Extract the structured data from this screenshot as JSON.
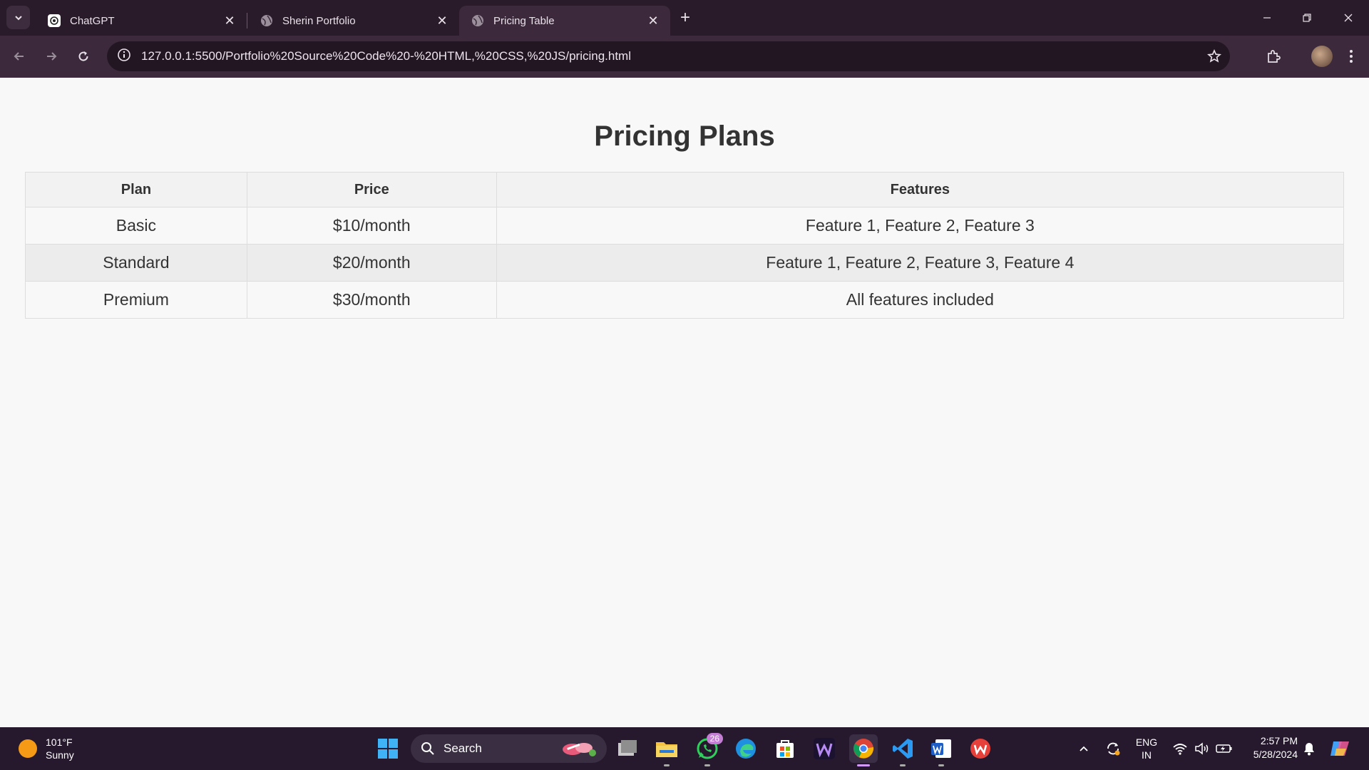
{
  "browser": {
    "tabs": [
      {
        "title": "ChatGPT",
        "favicon": "chatgpt-icon"
      },
      {
        "title": "Sherin Portfolio",
        "favicon": "globe-icon"
      },
      {
        "title": "Pricing Table",
        "favicon": "globe-icon",
        "active": true
      }
    ],
    "url": "127.0.0.1:5500/Portfolio%20Source%20Code%20-%20HTML,%20CSS,%20JS/pricing.html"
  },
  "page": {
    "title": "Pricing Plans",
    "table": {
      "headers": [
        "Plan",
        "Price",
        "Features"
      ],
      "rows": [
        [
          "Basic",
          "$10/month",
          "Feature 1, Feature 2, Feature 3"
        ],
        [
          "Standard",
          "$20/month",
          "Feature 1, Feature 2, Feature 3, Feature 4"
        ],
        [
          "Premium",
          "$30/month",
          "All features included"
        ]
      ]
    }
  },
  "taskbar": {
    "weather": {
      "temp": "101°F",
      "condition": "Sunny"
    },
    "search_label": "Search",
    "whatsapp_badge": "26",
    "language": {
      "line1": "ENG",
      "line2": "IN"
    },
    "time": "2:57 PM",
    "date": "5/28/2024"
  },
  "colors": {
    "tabstrip": "#2a1b2a",
    "toolbar": "#3c2a3c",
    "page_bg": "#f8f8f8",
    "taskbar": "#26192e"
  }
}
